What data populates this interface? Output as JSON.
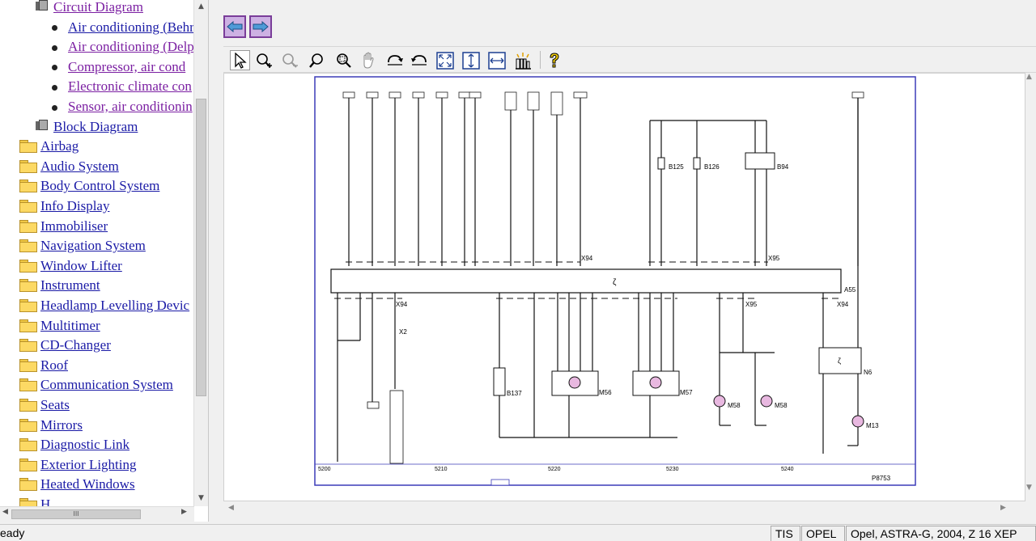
{
  "tree": {
    "items": [
      {
        "label": "Circuit Diagram",
        "type": "book",
        "level": 1,
        "visited": true
      },
      {
        "label": "Air conditioning (Behr",
        "type": "bullet",
        "level": 2,
        "visited": false
      },
      {
        "label": "Air conditioning (Delp",
        "type": "bullet",
        "level": 2,
        "visited": true
      },
      {
        "label": "Compressor, air cond",
        "type": "bullet",
        "level": 2,
        "visited": true
      },
      {
        "label": "Electronic climate con",
        "type": "bullet",
        "level": 2,
        "visited": true
      },
      {
        "label": "Sensor, air conditionin",
        "type": "bullet",
        "level": 2,
        "visited": true
      },
      {
        "label": "Block Diagram",
        "type": "book",
        "level": 1,
        "visited": false
      },
      {
        "label": "Airbag",
        "type": "folder",
        "level": 0,
        "visited": false
      },
      {
        "label": "Audio System",
        "type": "folder",
        "level": 0,
        "visited": false
      },
      {
        "label": "Body Control System",
        "type": "folder",
        "level": 0,
        "visited": false
      },
      {
        "label": "Info Display",
        "type": "folder",
        "level": 0,
        "visited": false
      },
      {
        "label": "Immobiliser",
        "type": "folder",
        "level": 0,
        "visited": false
      },
      {
        "label": "Navigation System",
        "type": "folder",
        "level": 0,
        "visited": false
      },
      {
        "label": "Window Lifter",
        "type": "folder",
        "level": 0,
        "visited": false
      },
      {
        "label": "Instrument",
        "type": "folder",
        "level": 0,
        "visited": false
      },
      {
        "label": "Headlamp Levelling Devic",
        "type": "folder",
        "level": 0,
        "visited": false
      },
      {
        "label": "Multitimer",
        "type": "folder",
        "level": 0,
        "visited": false
      },
      {
        "label": "CD-Changer",
        "type": "folder",
        "level": 0,
        "visited": false
      },
      {
        "label": "Roof",
        "type": "folder",
        "level": 0,
        "visited": false
      },
      {
        "label": "Communication System",
        "type": "folder",
        "level": 0,
        "visited": false
      },
      {
        "label": "Seats",
        "type": "folder",
        "level": 0,
        "visited": false
      },
      {
        "label": "Mirrors",
        "type": "folder",
        "level": 0,
        "visited": false
      },
      {
        "label": "Diagnostic Link",
        "type": "folder",
        "level": 0,
        "visited": false
      },
      {
        "label": "Exterior Lighting",
        "type": "folder",
        "level": 0,
        "visited": false
      },
      {
        "label": "Heated Windows",
        "type": "folder",
        "level": 0,
        "visited": false
      },
      {
        "label": "H...",
        "type": "folder",
        "level": 0,
        "visited": false
      }
    ]
  },
  "toolbar": {
    "tools": [
      "select-arrow-icon",
      "zoom-in-icon",
      "zoom-out-icon",
      "zoom-icon",
      "zoom-area-icon",
      "pan-hand-icon",
      "rotate-right-icon",
      "rotate-left-icon",
      "fit-page-icon",
      "fit-height-icon",
      "fit-width-icon",
      "highlight-icon",
      "help-icon"
    ]
  },
  "diagram": {
    "components": {
      "m56": "M56",
      "m57": "M57",
      "m58a": "M58",
      "m58b": "M58",
      "b137": "B137",
      "b125": "B125",
      "b126": "B126",
      "b94": "B94",
      "n6": "N6",
      "m13": "M13",
      "a55": "A55",
      "x94a": "X94",
      "x94b": "X94",
      "x94c": "X94",
      "x95a": "X95",
      "x95b": "X95",
      "x2": "X2"
    },
    "page_ref": "P8753",
    "scale_left": "5200",
    "scale_labels": [
      "5210",
      "5220",
      "5230",
      "5240"
    ]
  },
  "status": {
    "left": "eady",
    "cells": [
      "TIS",
      "OPEL",
      "Opel, ASTRA-G, 2004, Z 16 XEP"
    ]
  },
  "colors": {
    "nav_button_fill": "#cdb1e3",
    "nav_button_border": "#7a3d99",
    "link": "#1a1aa6",
    "visited_link": "#7b1fa2",
    "diagram_frame": "#3b3bb8",
    "module_fill": "#e9e9f7"
  }
}
